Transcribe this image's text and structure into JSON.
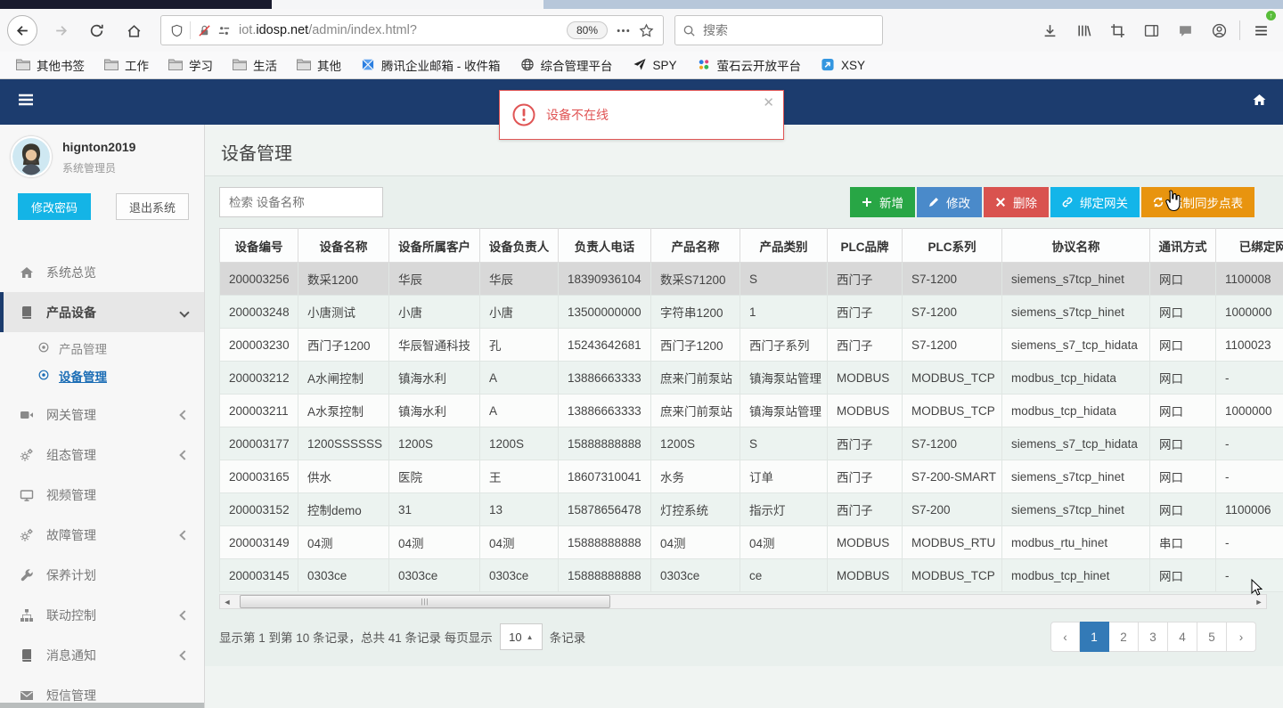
{
  "browser": {
    "url": {
      "subdomain": "iot.",
      "domain": "idosp.net",
      "path": "/admin/index.html?"
    },
    "zoom_level": "80%",
    "search_placeholder": "搜索",
    "bookmarks": [
      {
        "label": "其他书签",
        "icon": "folder"
      },
      {
        "label": "工作",
        "icon": "folder"
      },
      {
        "label": "学习",
        "icon": "folder"
      },
      {
        "label": "生活",
        "icon": "folder"
      },
      {
        "label": "其他",
        "icon": "folder"
      },
      {
        "label": "腾讯企业邮箱 - 收件箱",
        "icon": "exmail"
      },
      {
        "label": "综合管理平台",
        "icon": "globe"
      },
      {
        "label": "SPY",
        "icon": "plane"
      },
      {
        "label": "萤石云开放平台",
        "icon": "dots4"
      },
      {
        "label": "XSY",
        "icon": "xsy"
      }
    ]
  },
  "app": {
    "sidebar": {
      "user": {
        "name": "hignton2019",
        "role": "系统管理员"
      },
      "change_password_label": "修改密码",
      "logout_label": "退出系统",
      "menu": [
        {
          "label": "系统总览",
          "icon": "home"
        },
        {
          "label": "产品设备",
          "icon": "book",
          "active": true,
          "chevron": "down",
          "children": [
            {
              "label": "产品管理",
              "active": false
            },
            {
              "label": "设备管理",
              "active": true
            }
          ]
        },
        {
          "label": "网关管理",
          "icon": "video",
          "chevron": "left"
        },
        {
          "label": "组态管理",
          "icon": "gears",
          "chevron": "left"
        },
        {
          "label": "视频管理",
          "icon": "monitor"
        },
        {
          "label": "故障管理",
          "icon": "gears",
          "chevron": "left"
        },
        {
          "label": "保养计划",
          "icon": "wrench"
        },
        {
          "label": "联动控制",
          "icon": "sitemap",
          "chevron": "left"
        },
        {
          "label": "消息通知",
          "icon": "book",
          "chevron": "left"
        },
        {
          "label": "短信管理",
          "icon": "envelope"
        }
      ]
    },
    "alert": {
      "text": "设备不在线"
    },
    "main": {
      "title": "设备管理",
      "search_placeholder": "检索 设备名称",
      "actions": [
        {
          "label": "新增",
          "icon": "plus",
          "color": "#28a645"
        },
        {
          "label": "修改",
          "icon": "pencil",
          "color": "#4a8aca"
        },
        {
          "label": "删除",
          "icon": "xmark",
          "color": "#d9534f"
        },
        {
          "label": "绑定网关",
          "icon": "link",
          "color": "#13b5e9"
        },
        {
          "label": "强制同步点表",
          "icon": "sync",
          "color": "#e8940f"
        }
      ],
      "table": {
        "headers": [
          "设备编号",
          "设备名称",
          "设备所属客户",
          "设备负责人",
          "负责人电话",
          "产品名称",
          "产品类别",
          "PLC品牌",
          "PLC系列",
          "协议名称",
          "通讯方式",
          "已绑定网关"
        ],
        "selected_row": 0,
        "rows": [
          [
            "200003256",
            "数采1200",
            "华辰",
            "华辰",
            "18390936104",
            "数采S71200",
            "S",
            "西门子",
            "S7-1200",
            "siemens_s7tcp_hinet",
            "网口",
            "1100008"
          ],
          [
            "200003248",
            "小唐测试",
            "小唐",
            "小唐",
            "13500000000",
            "字符串1200",
            "1",
            "西门子",
            "S7-1200",
            "siemens_s7tcp_hinet",
            "网口",
            "1000000"
          ],
          [
            "200003230",
            "西门子1200",
            "华辰智通科技",
            "孔",
            "15243642681",
            "西门子1200",
            "西门子系列",
            "西门子",
            "S7-1200",
            "siemens_s7_tcp_hidata",
            "网口",
            "1100023"
          ],
          [
            "200003212",
            "A水闸控制",
            "镇海水利",
            "A",
            "13886663333",
            "庶来门前泵站",
            "镇海泵站管理",
            "MODBUS",
            "MODBUS_TCP",
            "modbus_tcp_hidata",
            "网口",
            "-"
          ],
          [
            "200003211",
            "A水泵控制",
            "镇海水利",
            "A",
            "13886663333",
            "庶来门前泵站",
            "镇海泵站管理",
            "MODBUS",
            "MODBUS_TCP",
            "modbus_tcp_hidata",
            "网口",
            "1000000"
          ],
          [
            "200003177",
            "1200SSSSSS",
            "1200S",
            "1200S",
            "15888888888",
            "1200S",
            "S",
            "西门子",
            "S7-1200",
            "siemens_s7_tcp_hidata",
            "网口",
            "-"
          ],
          [
            "200003165",
            "供水",
            "医院",
            "王",
            "18607310041",
            "水务",
            "订单",
            "西门子",
            "S7-200-SMART",
            "siemens_s7tcp_hinet",
            "网口",
            "-"
          ],
          [
            "200003152",
            "控制demo",
            "31",
            "13",
            "15878656478",
            "灯控系统",
            "指示灯",
            "西门子",
            "S7-200",
            "siemens_s7tcp_hinet",
            "网口",
            "1100006"
          ],
          [
            "200003149",
            "04测",
            "04测",
            "04测",
            "15888888888",
            "04测",
            "04测",
            "MODBUS",
            "MODBUS_RTU",
            "modbus_rtu_hinet",
            "串口",
            "-"
          ],
          [
            "200003145",
            "0303ce",
            "0303ce",
            "0303ce",
            "15888888888",
            "0303ce",
            "ce",
            "MODBUS",
            "MODBUS_TCP",
            "modbus_tcp_hinet",
            "网口",
            "-"
          ]
        ]
      },
      "footer": {
        "summary_prefix": "显示第 1 到第 10 条记录，总共 41 条记录 每页显示",
        "page_size": "10",
        "summary_suffix": "条记录"
      },
      "pagination": {
        "pages": [
          "‹",
          "1",
          "2",
          "3",
          "4",
          "5",
          "›"
        ],
        "active": "1",
        "active_color": "#337ab7"
      }
    }
  }
}
